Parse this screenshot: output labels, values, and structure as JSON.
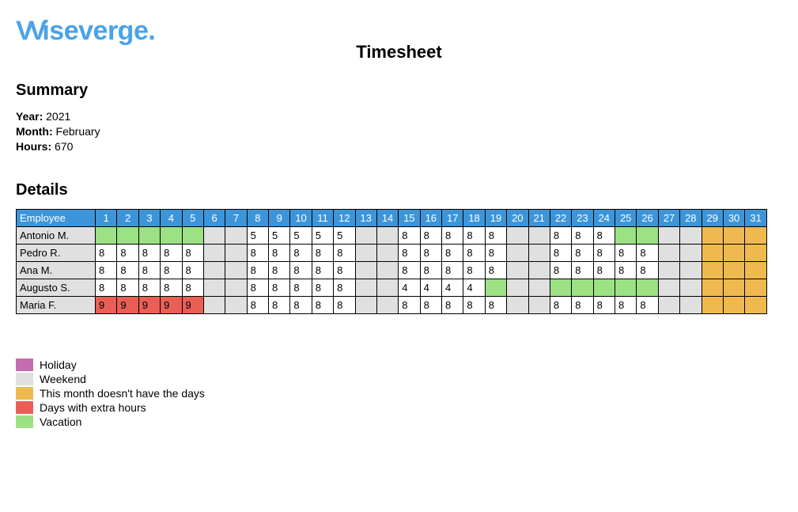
{
  "brand": "Wiseverge.",
  "title": "Timesheet",
  "sections": {
    "summary": "Summary",
    "details": "Details"
  },
  "summary": {
    "year_label": "Year:",
    "year_value": "2021",
    "month_label": "Month:",
    "month_value": "February",
    "hours_label": "Hours:",
    "hours_value": "670"
  },
  "table": {
    "employee_header": "Employee",
    "days": [
      "1",
      "2",
      "3",
      "4",
      "5",
      "6",
      "7",
      "8",
      "9",
      "10",
      "11",
      "12",
      "13",
      "14",
      "15",
      "16",
      "17",
      "18",
      "19",
      "20",
      "21",
      "22",
      "23",
      "24",
      "25",
      "26",
      "27",
      "28",
      "29",
      "30",
      "31"
    ]
  },
  "legend": {
    "holiday": "Holiday",
    "weekend": "Weekend",
    "nodays": "This month doesn't have the days",
    "extra": "Days with extra hours",
    "vacation": "Vacation"
  },
  "colors": {
    "header_bg": "#3d95d9",
    "weekend": "#e0e0e0",
    "holiday": "#c56bb0",
    "nodays": "#f0b94f",
    "extra": "#ea5f55",
    "vacation": "#9ce184",
    "brand": "#4aa3e8"
  },
  "chart_data": {
    "type": "table",
    "title": "Timesheet",
    "year": 2021,
    "month": "February",
    "total_hours": 670,
    "days": [
      1,
      2,
      3,
      4,
      5,
      6,
      7,
      8,
      9,
      10,
      11,
      12,
      13,
      14,
      15,
      16,
      17,
      18,
      19,
      20,
      21,
      22,
      23,
      24,
      25,
      26,
      27,
      28,
      29,
      30,
      31
    ],
    "status_codes": {
      "": "normal/empty",
      "w": "weekend",
      "v": "vacation",
      "e": "extra-hours",
      "n": "month-has-no-such-day",
      "h": "holiday"
    },
    "rows": [
      {
        "name": "Antonio M.",
        "cells": [
          {
            "v": "",
            "s": "v"
          },
          {
            "v": "",
            "s": "v"
          },
          {
            "v": "",
            "s": "v"
          },
          {
            "v": "",
            "s": "v"
          },
          {
            "v": "",
            "s": "v"
          },
          {
            "v": "",
            "s": "w"
          },
          {
            "v": "",
            "s": "w"
          },
          {
            "v": "5",
            "s": ""
          },
          {
            "v": "5",
            "s": ""
          },
          {
            "v": "5",
            "s": ""
          },
          {
            "v": "5",
            "s": ""
          },
          {
            "v": "5",
            "s": ""
          },
          {
            "v": "",
            "s": "w"
          },
          {
            "v": "",
            "s": "w"
          },
          {
            "v": "8",
            "s": ""
          },
          {
            "v": "8",
            "s": ""
          },
          {
            "v": "8",
            "s": ""
          },
          {
            "v": "8",
            "s": ""
          },
          {
            "v": "8",
            "s": ""
          },
          {
            "v": "",
            "s": "w"
          },
          {
            "v": "",
            "s": "w"
          },
          {
            "v": "8",
            "s": ""
          },
          {
            "v": "8",
            "s": ""
          },
          {
            "v": "8",
            "s": ""
          },
          {
            "v": "",
            "s": "v"
          },
          {
            "v": "",
            "s": "v"
          },
          {
            "v": "",
            "s": "w"
          },
          {
            "v": "",
            "s": "w"
          },
          {
            "v": "",
            "s": "n"
          },
          {
            "v": "",
            "s": "n"
          },
          {
            "v": "",
            "s": "n"
          }
        ]
      },
      {
        "name": "Pedro R.",
        "cells": [
          {
            "v": "8",
            "s": ""
          },
          {
            "v": "8",
            "s": ""
          },
          {
            "v": "8",
            "s": ""
          },
          {
            "v": "8",
            "s": ""
          },
          {
            "v": "8",
            "s": ""
          },
          {
            "v": "",
            "s": "w"
          },
          {
            "v": "",
            "s": "w"
          },
          {
            "v": "8",
            "s": ""
          },
          {
            "v": "8",
            "s": ""
          },
          {
            "v": "8",
            "s": ""
          },
          {
            "v": "8",
            "s": ""
          },
          {
            "v": "8",
            "s": ""
          },
          {
            "v": "",
            "s": "w"
          },
          {
            "v": "",
            "s": "w"
          },
          {
            "v": "8",
            "s": ""
          },
          {
            "v": "8",
            "s": ""
          },
          {
            "v": "8",
            "s": ""
          },
          {
            "v": "8",
            "s": ""
          },
          {
            "v": "8",
            "s": ""
          },
          {
            "v": "",
            "s": "w"
          },
          {
            "v": "",
            "s": "w"
          },
          {
            "v": "8",
            "s": ""
          },
          {
            "v": "8",
            "s": ""
          },
          {
            "v": "8",
            "s": ""
          },
          {
            "v": "8",
            "s": ""
          },
          {
            "v": "8",
            "s": ""
          },
          {
            "v": "",
            "s": "w"
          },
          {
            "v": "",
            "s": "w"
          },
          {
            "v": "",
            "s": "n"
          },
          {
            "v": "",
            "s": "n"
          },
          {
            "v": "",
            "s": "n"
          }
        ]
      },
      {
        "name": "Ana M.",
        "cells": [
          {
            "v": "8",
            "s": ""
          },
          {
            "v": "8",
            "s": ""
          },
          {
            "v": "8",
            "s": ""
          },
          {
            "v": "8",
            "s": ""
          },
          {
            "v": "8",
            "s": ""
          },
          {
            "v": "",
            "s": "w"
          },
          {
            "v": "",
            "s": "w"
          },
          {
            "v": "8",
            "s": ""
          },
          {
            "v": "8",
            "s": ""
          },
          {
            "v": "8",
            "s": ""
          },
          {
            "v": "8",
            "s": ""
          },
          {
            "v": "8",
            "s": ""
          },
          {
            "v": "",
            "s": "w"
          },
          {
            "v": "",
            "s": "w"
          },
          {
            "v": "8",
            "s": ""
          },
          {
            "v": "8",
            "s": ""
          },
          {
            "v": "8",
            "s": ""
          },
          {
            "v": "8",
            "s": ""
          },
          {
            "v": "8",
            "s": ""
          },
          {
            "v": "",
            "s": "w"
          },
          {
            "v": "",
            "s": "w"
          },
          {
            "v": "8",
            "s": ""
          },
          {
            "v": "8",
            "s": ""
          },
          {
            "v": "8",
            "s": ""
          },
          {
            "v": "8",
            "s": ""
          },
          {
            "v": "8",
            "s": ""
          },
          {
            "v": "",
            "s": "w"
          },
          {
            "v": "",
            "s": "w"
          },
          {
            "v": "",
            "s": "n"
          },
          {
            "v": "",
            "s": "n"
          },
          {
            "v": "",
            "s": "n"
          }
        ]
      },
      {
        "name": "Augusto S.",
        "cells": [
          {
            "v": "8",
            "s": ""
          },
          {
            "v": "8",
            "s": ""
          },
          {
            "v": "8",
            "s": ""
          },
          {
            "v": "8",
            "s": ""
          },
          {
            "v": "8",
            "s": ""
          },
          {
            "v": "",
            "s": "w"
          },
          {
            "v": "",
            "s": "w"
          },
          {
            "v": "8",
            "s": ""
          },
          {
            "v": "8",
            "s": ""
          },
          {
            "v": "8",
            "s": ""
          },
          {
            "v": "8",
            "s": ""
          },
          {
            "v": "8",
            "s": ""
          },
          {
            "v": "",
            "s": "w"
          },
          {
            "v": "",
            "s": "w"
          },
          {
            "v": "4",
            "s": ""
          },
          {
            "v": "4",
            "s": ""
          },
          {
            "v": "4",
            "s": ""
          },
          {
            "v": "4",
            "s": ""
          },
          {
            "v": "",
            "s": "v"
          },
          {
            "v": "",
            "s": "w"
          },
          {
            "v": "",
            "s": "w"
          },
          {
            "v": "",
            "s": "v"
          },
          {
            "v": "",
            "s": "v"
          },
          {
            "v": "",
            "s": "v"
          },
          {
            "v": "",
            "s": "v"
          },
          {
            "v": "",
            "s": "v"
          },
          {
            "v": "",
            "s": "w"
          },
          {
            "v": "",
            "s": "w"
          },
          {
            "v": "",
            "s": "n"
          },
          {
            "v": "",
            "s": "n"
          },
          {
            "v": "",
            "s": "n"
          }
        ]
      },
      {
        "name": "Maria F.",
        "cells": [
          {
            "v": "9",
            "s": "e"
          },
          {
            "v": "9",
            "s": "e"
          },
          {
            "v": "9",
            "s": "e"
          },
          {
            "v": "9",
            "s": "e"
          },
          {
            "v": "9",
            "s": "e"
          },
          {
            "v": "",
            "s": "w"
          },
          {
            "v": "",
            "s": "w"
          },
          {
            "v": "8",
            "s": ""
          },
          {
            "v": "8",
            "s": ""
          },
          {
            "v": "8",
            "s": ""
          },
          {
            "v": "8",
            "s": ""
          },
          {
            "v": "8",
            "s": ""
          },
          {
            "v": "",
            "s": "w"
          },
          {
            "v": "",
            "s": "w"
          },
          {
            "v": "8",
            "s": ""
          },
          {
            "v": "8",
            "s": ""
          },
          {
            "v": "8",
            "s": ""
          },
          {
            "v": "8",
            "s": ""
          },
          {
            "v": "8",
            "s": ""
          },
          {
            "v": "",
            "s": "w"
          },
          {
            "v": "",
            "s": "w"
          },
          {
            "v": "8",
            "s": ""
          },
          {
            "v": "8",
            "s": ""
          },
          {
            "v": "8",
            "s": ""
          },
          {
            "v": "8",
            "s": ""
          },
          {
            "v": "8",
            "s": ""
          },
          {
            "v": "",
            "s": "w"
          },
          {
            "v": "",
            "s": "w"
          },
          {
            "v": "",
            "s": "n"
          },
          {
            "v": "",
            "s": "n"
          },
          {
            "v": "",
            "s": "n"
          }
        ]
      }
    ]
  }
}
